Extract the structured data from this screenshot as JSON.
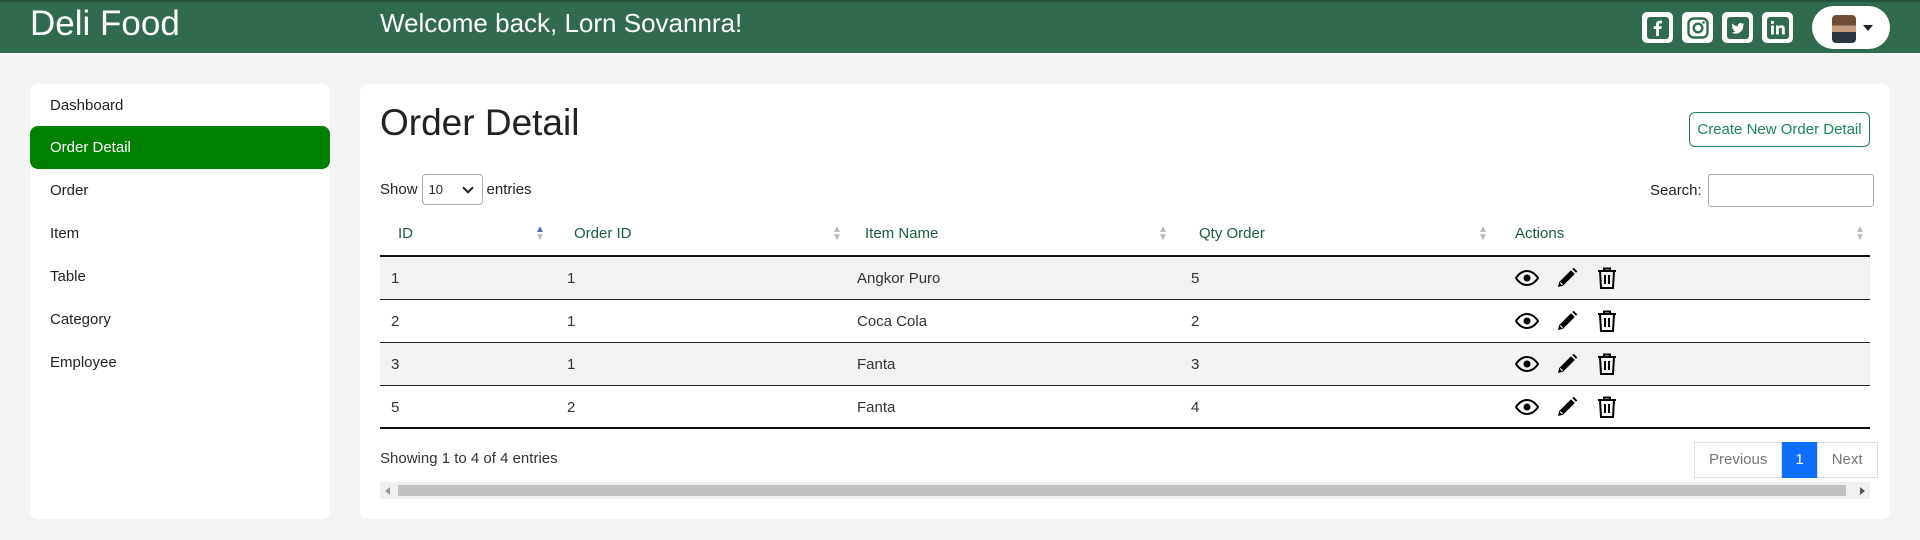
{
  "header": {
    "brand": "Deli Food",
    "welcome": "Welcome back, Lorn Sovannra!",
    "social": [
      "facebook-icon",
      "instagram-icon",
      "twitter-icon",
      "linkedin-icon"
    ]
  },
  "sidebar": {
    "items": [
      {
        "label": "Dashboard",
        "active": false
      },
      {
        "label": "Order Detail",
        "active": true
      },
      {
        "label": "Order",
        "active": false
      },
      {
        "label": "Item",
        "active": false
      },
      {
        "label": "Table",
        "active": false
      },
      {
        "label": "Category",
        "active": false
      },
      {
        "label": "Employee",
        "active": false
      }
    ]
  },
  "main": {
    "title": "Order Detail",
    "create_button": "Create New Order Detail",
    "show_label": "Show",
    "entries_value": "10",
    "entries_label": "entries",
    "search_label": "Search:",
    "columns": [
      "ID",
      "Order ID",
      "Item Name",
      "Qty Order",
      "Actions"
    ],
    "rows": [
      [
        "1",
        "1",
        "Angkor Puro",
        "5"
      ],
      [
        "2",
        "1",
        "Coca Cola",
        "2"
      ],
      [
        "3",
        "1",
        "Fanta",
        "3"
      ],
      [
        "5",
        "2",
        "Fanta",
        "4"
      ]
    ],
    "info": "Showing 1 to 4 of 4 entries",
    "pager": {
      "previous": "Previous",
      "page": "1",
      "next": "Next"
    }
  },
  "colors": {
    "header": "#306b4f",
    "active": "#008000",
    "create": "#198754",
    "page": "#0d6efd"
  }
}
